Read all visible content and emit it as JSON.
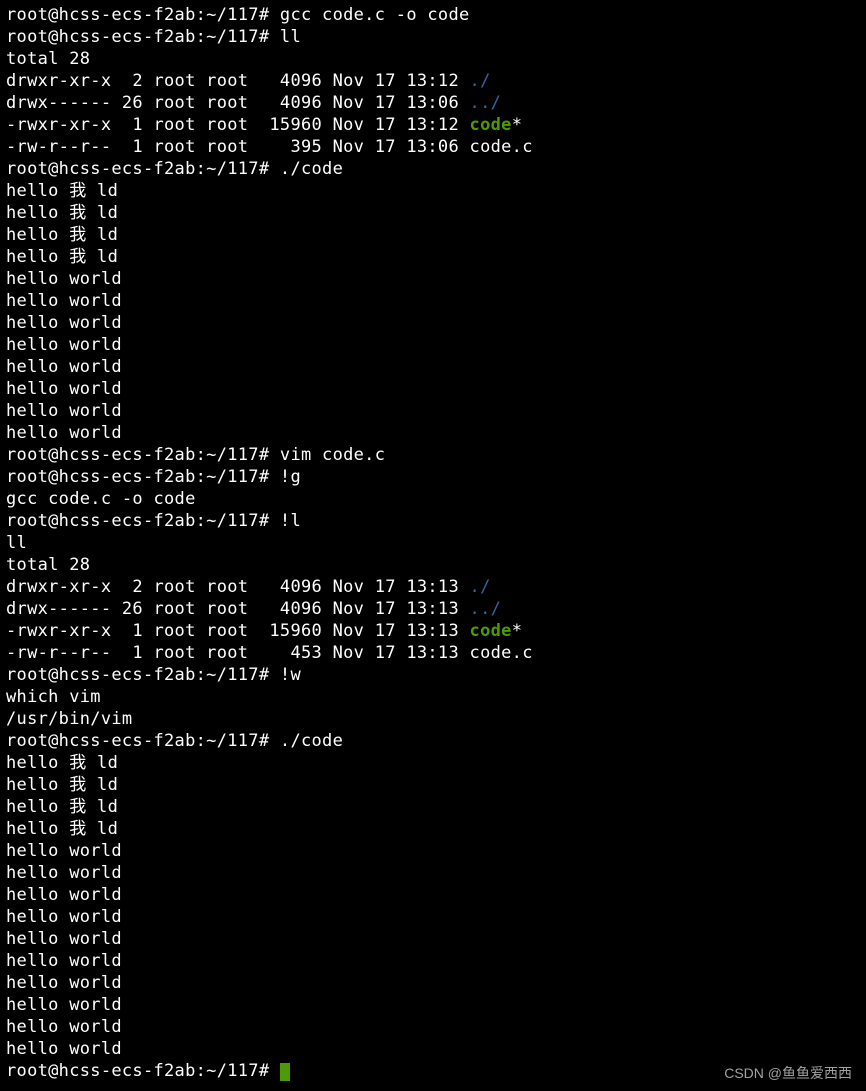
{
  "colors": {
    "bg": "#000000",
    "fg": "#ffffff",
    "dir": "#3465a4",
    "exec": "#4e9a06",
    "cursor": "#4e9a06",
    "watermark": "#bfbfbf"
  },
  "prompt": "root@hcss-ecs-f2ab:~/117# ",
  "lines": [
    {
      "type": "prompt",
      "cmd": "gcc code.c -o code"
    },
    {
      "type": "prompt",
      "cmd": "ll"
    },
    {
      "type": "text",
      "text": "total 28"
    },
    {
      "type": "ls",
      "perm": "drwxr-xr-x",
      "n": " 2",
      "own": "root root",
      "size": "  4096",
      "date": "Nov 17 13:12",
      "name": "./",
      "cls": "dir-self"
    },
    {
      "type": "ls",
      "perm": "drwx------",
      "n": "26",
      "own": "root root",
      "size": "  4096",
      "date": "Nov 17 13:06",
      "name": "../",
      "cls": "dir-self"
    },
    {
      "type": "ls",
      "perm": "-rwxr-xr-x",
      "n": " 1",
      "own": "root root",
      "size": " 15960",
      "date": "Nov 17 13:12",
      "name": "code",
      "cls": "exec-file",
      "suffix": "*"
    },
    {
      "type": "ls",
      "perm": "-rw-r--r--",
      "n": " 1",
      "own": "root root",
      "size": "   395",
      "date": "Nov 17 13:06",
      "name": "code.c",
      "cls": "plain"
    },
    {
      "type": "prompt",
      "cmd": "./code"
    },
    {
      "type": "text",
      "text": "hello 我 ld"
    },
    {
      "type": "text",
      "text": "hello 我 ld"
    },
    {
      "type": "text",
      "text": "hello 我 ld"
    },
    {
      "type": "text",
      "text": "hello 我 ld"
    },
    {
      "type": "text",
      "text": "hello world"
    },
    {
      "type": "text",
      "text": "hello world"
    },
    {
      "type": "text",
      "text": "hello world"
    },
    {
      "type": "text",
      "text": "hello world"
    },
    {
      "type": "text",
      "text": "hello world"
    },
    {
      "type": "text",
      "text": "hello world"
    },
    {
      "type": "text",
      "text": "hello world"
    },
    {
      "type": "text",
      "text": "hello world"
    },
    {
      "type": "prompt",
      "cmd": "vim code.c"
    },
    {
      "type": "prompt",
      "cmd": "!g"
    },
    {
      "type": "text",
      "text": "gcc code.c -o code"
    },
    {
      "type": "prompt",
      "cmd": "!l"
    },
    {
      "type": "text",
      "text": "ll"
    },
    {
      "type": "text",
      "text": "total 28"
    },
    {
      "type": "ls",
      "perm": "drwxr-xr-x",
      "n": " 2",
      "own": "root root",
      "size": "  4096",
      "date": "Nov 17 13:13",
      "name": "./",
      "cls": "dir-self"
    },
    {
      "type": "ls",
      "perm": "drwx------",
      "n": "26",
      "own": "root root",
      "size": "  4096",
      "date": "Nov 17 13:13",
      "name": "../",
      "cls": "dir-self"
    },
    {
      "type": "ls",
      "perm": "-rwxr-xr-x",
      "n": " 1",
      "own": "root root",
      "size": " 15960",
      "date": "Nov 17 13:13",
      "name": "code",
      "cls": "exec-file",
      "suffix": "*"
    },
    {
      "type": "ls",
      "perm": "-rw-r--r--",
      "n": " 1",
      "own": "root root",
      "size": "   453",
      "date": "Nov 17 13:13",
      "name": "code.c",
      "cls": "plain"
    },
    {
      "type": "prompt",
      "cmd": "!w"
    },
    {
      "type": "text",
      "text": "which vim"
    },
    {
      "type": "text",
      "text": "/usr/bin/vim"
    },
    {
      "type": "prompt",
      "cmd": "./code"
    },
    {
      "type": "text",
      "text": "hello 我 ld"
    },
    {
      "type": "text",
      "text": "hello 我 ld"
    },
    {
      "type": "text",
      "text": "hello 我 ld"
    },
    {
      "type": "text",
      "text": "hello 我 ld"
    },
    {
      "type": "text",
      "text": "hello world"
    },
    {
      "type": "text",
      "text": "hello world"
    },
    {
      "type": "text",
      "text": "hello world"
    },
    {
      "type": "text",
      "text": "hello world"
    },
    {
      "type": "text",
      "text": "hello world"
    },
    {
      "type": "text",
      "text": "hello world"
    },
    {
      "type": "text",
      "text": "hello world"
    },
    {
      "type": "text",
      "text": "hello world"
    },
    {
      "type": "text",
      "text": "hello world"
    },
    {
      "type": "text",
      "text": "hello world"
    },
    {
      "type": "prompt",
      "cmd": "",
      "cursor": true
    }
  ],
  "watermark": "CSDN @鱼鱼爱西西"
}
